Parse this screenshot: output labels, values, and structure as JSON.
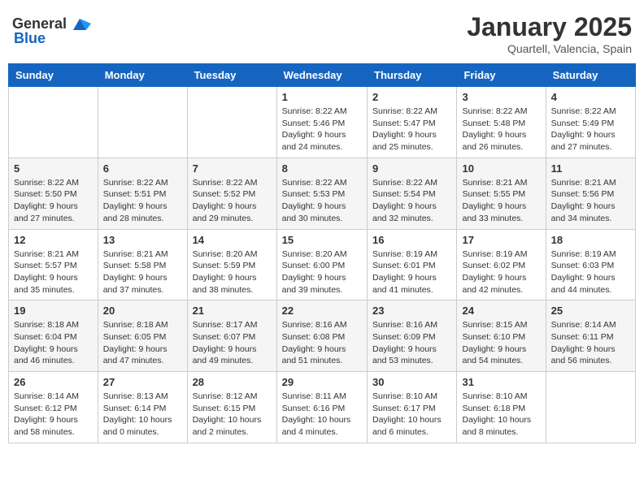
{
  "header": {
    "logo_general": "General",
    "logo_blue": "Blue",
    "month": "January 2025",
    "location": "Quartell, Valencia, Spain"
  },
  "weekdays": [
    "Sunday",
    "Monday",
    "Tuesday",
    "Wednesday",
    "Thursday",
    "Friday",
    "Saturday"
  ],
  "weeks": [
    [
      {
        "day": "",
        "info": ""
      },
      {
        "day": "",
        "info": ""
      },
      {
        "day": "",
        "info": ""
      },
      {
        "day": "1",
        "info": "Sunrise: 8:22 AM\nSunset: 5:46 PM\nDaylight: 9 hours and 24 minutes."
      },
      {
        "day": "2",
        "info": "Sunrise: 8:22 AM\nSunset: 5:47 PM\nDaylight: 9 hours and 25 minutes."
      },
      {
        "day": "3",
        "info": "Sunrise: 8:22 AM\nSunset: 5:48 PM\nDaylight: 9 hours and 26 minutes."
      },
      {
        "day": "4",
        "info": "Sunrise: 8:22 AM\nSunset: 5:49 PM\nDaylight: 9 hours and 27 minutes."
      }
    ],
    [
      {
        "day": "5",
        "info": "Sunrise: 8:22 AM\nSunset: 5:50 PM\nDaylight: 9 hours and 27 minutes."
      },
      {
        "day": "6",
        "info": "Sunrise: 8:22 AM\nSunset: 5:51 PM\nDaylight: 9 hours and 28 minutes."
      },
      {
        "day": "7",
        "info": "Sunrise: 8:22 AM\nSunset: 5:52 PM\nDaylight: 9 hours and 29 minutes."
      },
      {
        "day": "8",
        "info": "Sunrise: 8:22 AM\nSunset: 5:53 PM\nDaylight: 9 hours and 30 minutes."
      },
      {
        "day": "9",
        "info": "Sunrise: 8:22 AM\nSunset: 5:54 PM\nDaylight: 9 hours and 32 minutes."
      },
      {
        "day": "10",
        "info": "Sunrise: 8:21 AM\nSunset: 5:55 PM\nDaylight: 9 hours and 33 minutes."
      },
      {
        "day": "11",
        "info": "Sunrise: 8:21 AM\nSunset: 5:56 PM\nDaylight: 9 hours and 34 minutes."
      }
    ],
    [
      {
        "day": "12",
        "info": "Sunrise: 8:21 AM\nSunset: 5:57 PM\nDaylight: 9 hours and 35 minutes."
      },
      {
        "day": "13",
        "info": "Sunrise: 8:21 AM\nSunset: 5:58 PM\nDaylight: 9 hours and 37 minutes."
      },
      {
        "day": "14",
        "info": "Sunrise: 8:20 AM\nSunset: 5:59 PM\nDaylight: 9 hours and 38 minutes."
      },
      {
        "day": "15",
        "info": "Sunrise: 8:20 AM\nSunset: 6:00 PM\nDaylight: 9 hours and 39 minutes."
      },
      {
        "day": "16",
        "info": "Sunrise: 8:19 AM\nSunset: 6:01 PM\nDaylight: 9 hours and 41 minutes."
      },
      {
        "day": "17",
        "info": "Sunrise: 8:19 AM\nSunset: 6:02 PM\nDaylight: 9 hours and 42 minutes."
      },
      {
        "day": "18",
        "info": "Sunrise: 8:19 AM\nSunset: 6:03 PM\nDaylight: 9 hours and 44 minutes."
      }
    ],
    [
      {
        "day": "19",
        "info": "Sunrise: 8:18 AM\nSunset: 6:04 PM\nDaylight: 9 hours and 46 minutes."
      },
      {
        "day": "20",
        "info": "Sunrise: 8:18 AM\nSunset: 6:05 PM\nDaylight: 9 hours and 47 minutes."
      },
      {
        "day": "21",
        "info": "Sunrise: 8:17 AM\nSunset: 6:07 PM\nDaylight: 9 hours and 49 minutes."
      },
      {
        "day": "22",
        "info": "Sunrise: 8:16 AM\nSunset: 6:08 PM\nDaylight: 9 hours and 51 minutes."
      },
      {
        "day": "23",
        "info": "Sunrise: 8:16 AM\nSunset: 6:09 PM\nDaylight: 9 hours and 53 minutes."
      },
      {
        "day": "24",
        "info": "Sunrise: 8:15 AM\nSunset: 6:10 PM\nDaylight: 9 hours and 54 minutes."
      },
      {
        "day": "25",
        "info": "Sunrise: 8:14 AM\nSunset: 6:11 PM\nDaylight: 9 hours and 56 minutes."
      }
    ],
    [
      {
        "day": "26",
        "info": "Sunrise: 8:14 AM\nSunset: 6:12 PM\nDaylight: 9 hours and 58 minutes."
      },
      {
        "day": "27",
        "info": "Sunrise: 8:13 AM\nSunset: 6:14 PM\nDaylight: 10 hours and 0 minutes."
      },
      {
        "day": "28",
        "info": "Sunrise: 8:12 AM\nSunset: 6:15 PM\nDaylight: 10 hours and 2 minutes."
      },
      {
        "day": "29",
        "info": "Sunrise: 8:11 AM\nSunset: 6:16 PM\nDaylight: 10 hours and 4 minutes."
      },
      {
        "day": "30",
        "info": "Sunrise: 8:10 AM\nSunset: 6:17 PM\nDaylight: 10 hours and 6 minutes."
      },
      {
        "day": "31",
        "info": "Sunrise: 8:10 AM\nSunset: 6:18 PM\nDaylight: 10 hours and 8 minutes."
      },
      {
        "day": "",
        "info": ""
      }
    ]
  ]
}
